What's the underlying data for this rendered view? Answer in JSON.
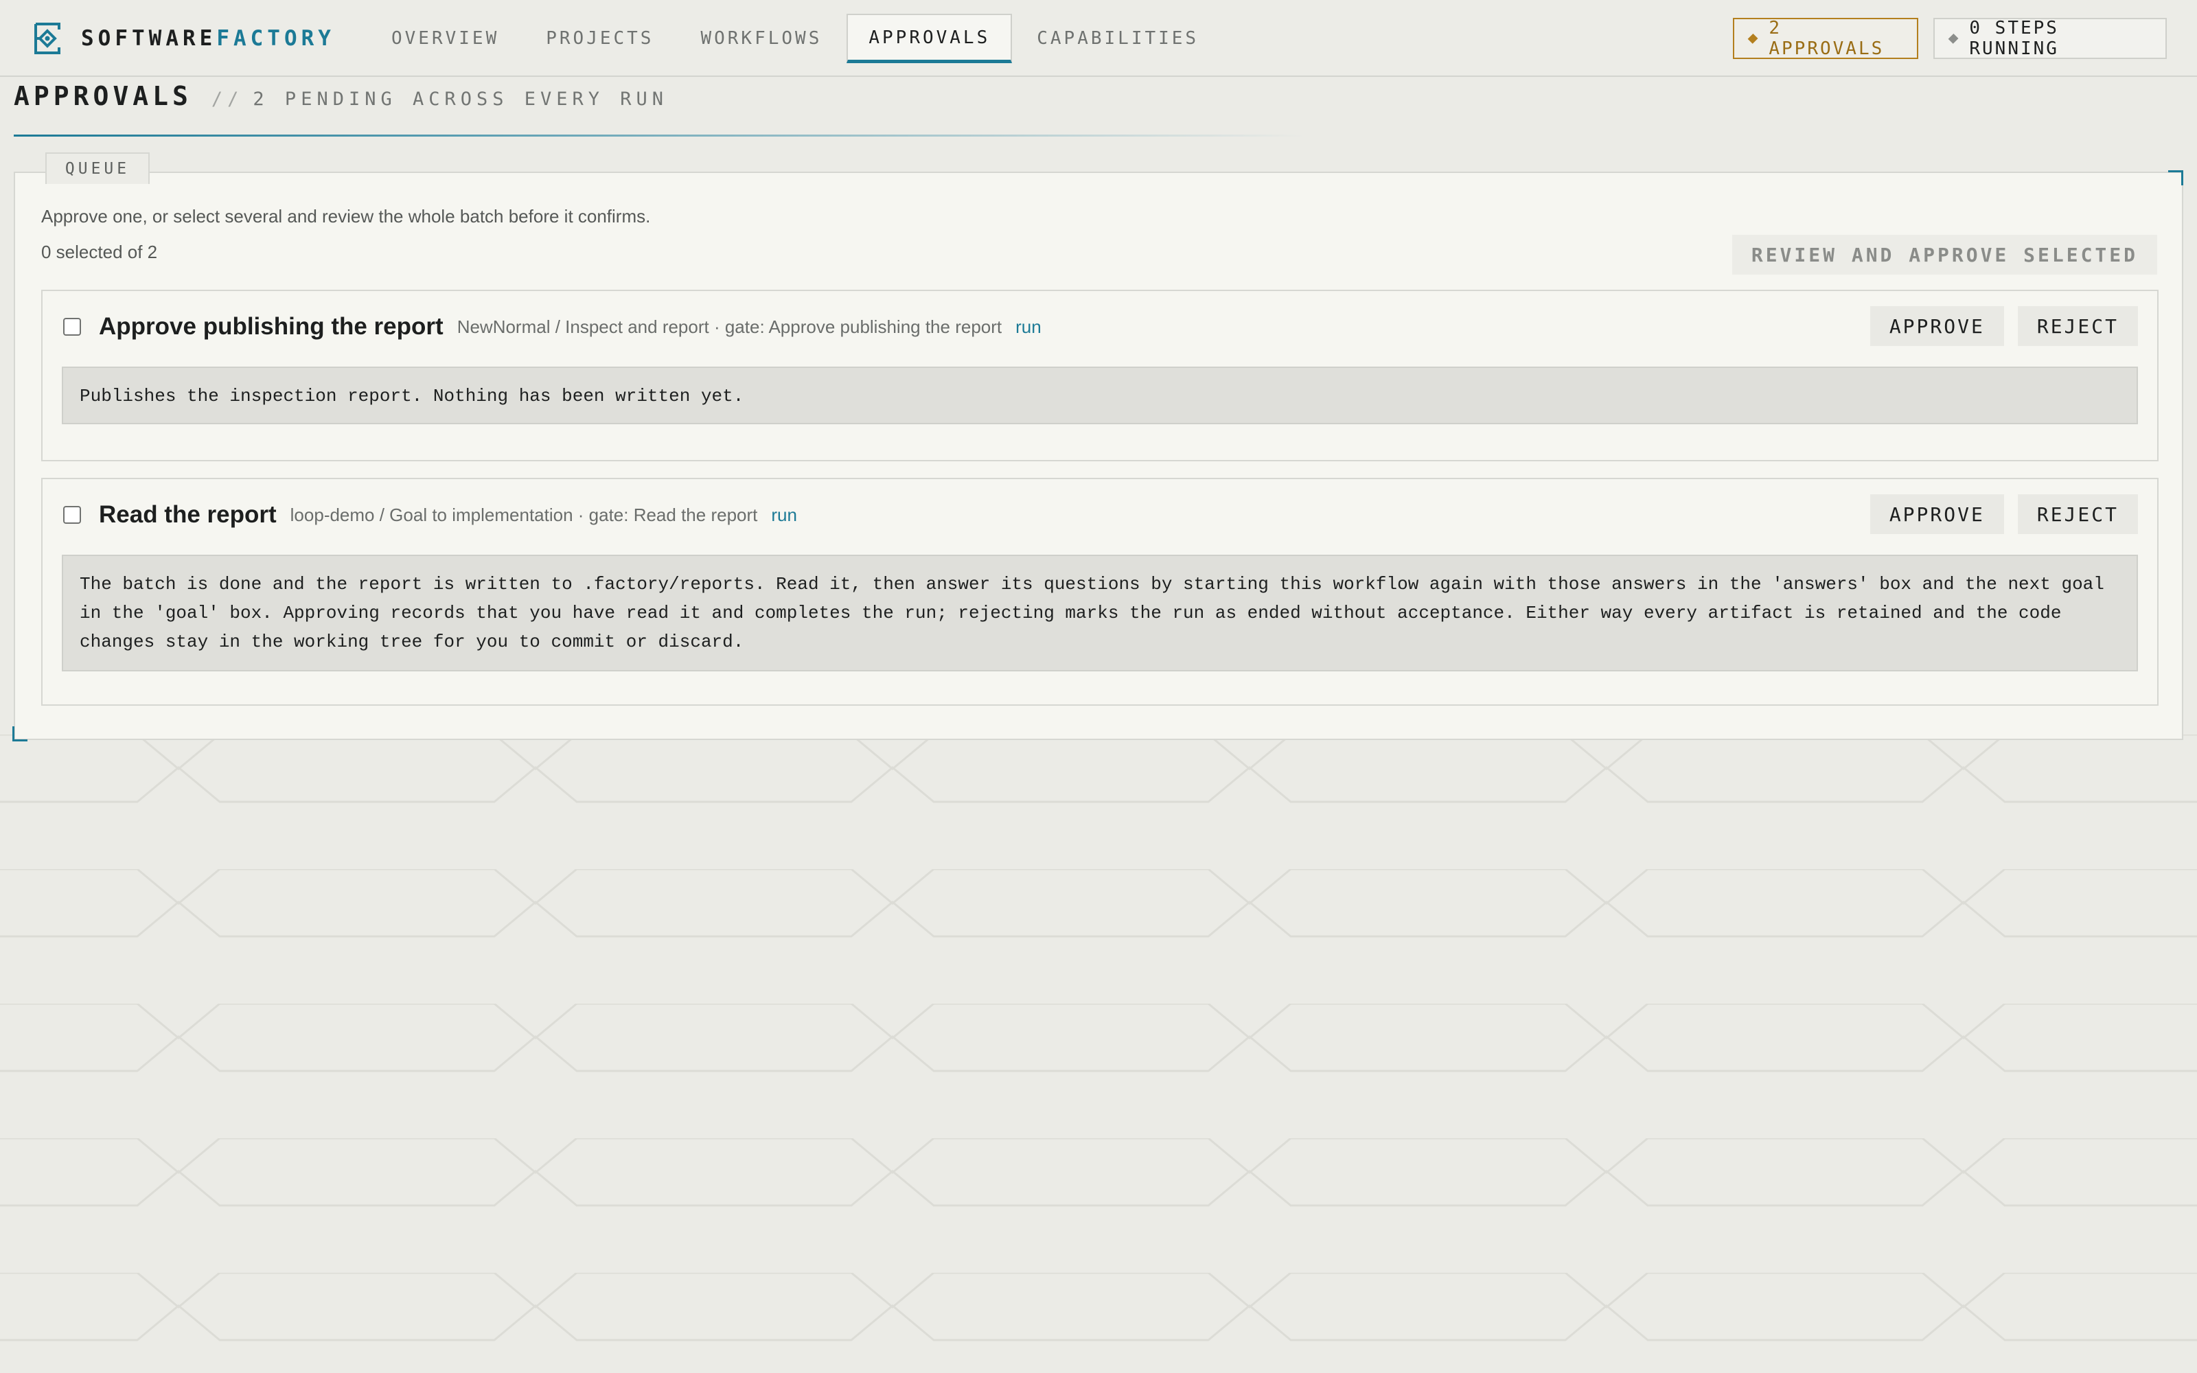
{
  "app": {
    "brand_primary": "SOFTWARE",
    "brand_accent": "FACTORY",
    "accent_color": "#1c7a96",
    "warning_color": "#b37f1e"
  },
  "nav": {
    "tabs": [
      {
        "label": "OVERVIEW",
        "active": false
      },
      {
        "label": "PROJECTS",
        "active": false
      },
      {
        "label": "WORKFLOWS",
        "active": false
      },
      {
        "label": "APPROVALS",
        "active": true
      },
      {
        "label": "CAPABILITIES",
        "active": false
      }
    ]
  },
  "status": {
    "approvals": "2 APPROVALS",
    "steps": "0 STEPS RUNNING"
  },
  "page": {
    "title": "APPROVALS",
    "subtitle_prefix": "//",
    "subtitle": "2 PENDING ACROSS EVERY RUN"
  },
  "queue": {
    "tab_label": "QUEUE",
    "intro": "Approve one, or select several and review the whole batch before it confirms.",
    "selected_count": "0 selected of 2",
    "batch_button": "REVIEW AND APPROVE SELECTED",
    "items": [
      {
        "title": "Approve publishing the report",
        "meta": "NewNormal / Inspect and report · gate: Approve publishing the report",
        "run_link": "run",
        "approve": "APPROVE",
        "reject": "REJECT",
        "checked": false,
        "body": "Publishes the inspection report. Nothing has been written yet."
      },
      {
        "title": "Read the report",
        "meta": "loop-demo / Goal to implementation · gate: Read the report",
        "run_link": "run",
        "approve": "APPROVE",
        "reject": "REJECT",
        "checked": false,
        "body": "The batch is done and the report is written to .factory/reports. Read it, then answer its questions by starting this workflow again with those answers in the 'answers' box and the next goal in the 'goal' box. Approving records that you have read it and completes the run; rejecting marks the run as ended without acceptance. Either way every artifact is retained and the code changes stay in the working tree for you to commit or discard."
      }
    ]
  }
}
